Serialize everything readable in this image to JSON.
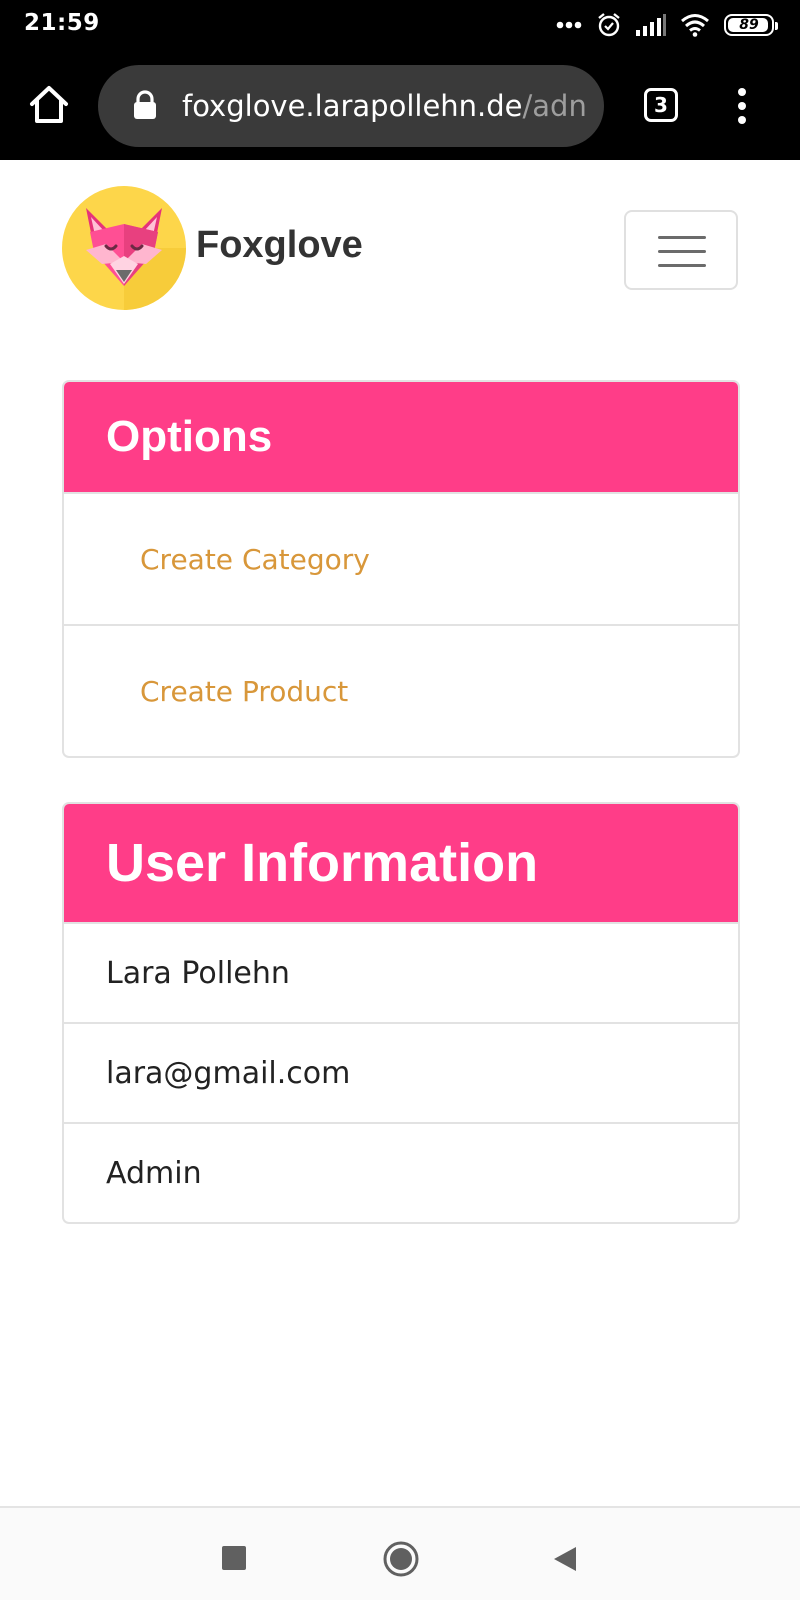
{
  "status_bar": {
    "time": "21:59",
    "battery_level": "89",
    "icons": [
      "more-dots-icon",
      "alarm-icon",
      "signal-icon",
      "wifi-icon",
      "battery-icon"
    ]
  },
  "browser": {
    "url_host": "foxglove.larapollehn.de",
    "url_path": "/adn",
    "tab_count": "3",
    "icons": [
      "home-icon",
      "lock-icon",
      "tabs-icon",
      "menu-dots-icon"
    ]
  },
  "navbar": {
    "brand": "Foxglove",
    "logo_icon": "fox-logo-icon",
    "toggler_icon": "hamburger-icon"
  },
  "options_card": {
    "title": "Options",
    "items": [
      {
        "label": "Create Category"
      },
      {
        "label": "Create Product"
      }
    ]
  },
  "user_card": {
    "title": "User Information",
    "name": "Lara Pollehn",
    "email": "lara@gmail.com",
    "role": "Admin"
  },
  "colors": {
    "accent": "#ff3d88",
    "link": "#d8973a",
    "brand_text": "#333333",
    "logo_bg": "#fdd64a"
  },
  "system_nav": {
    "icons": [
      "recent-apps-icon",
      "home-circle-icon",
      "back-icon"
    ]
  }
}
